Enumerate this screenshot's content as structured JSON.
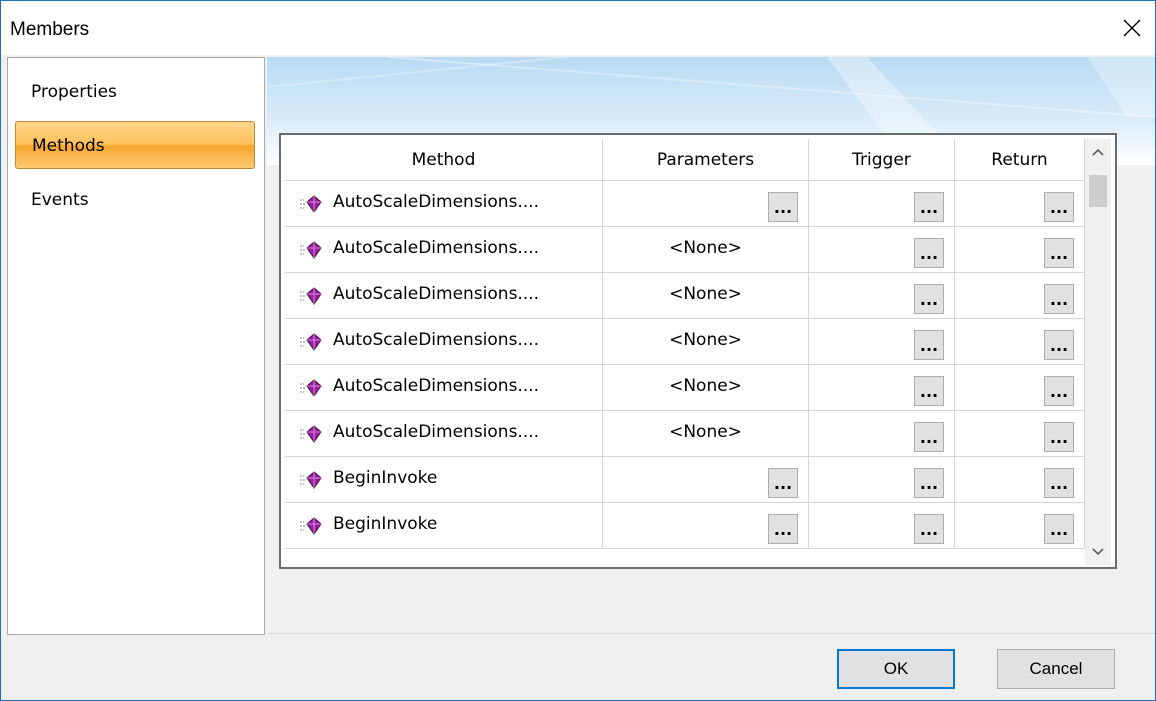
{
  "window": {
    "title": "Members",
    "close_icon": "close-icon"
  },
  "sidebar": {
    "items": [
      {
        "label": "Properties",
        "selected": false
      },
      {
        "label": "Methods",
        "selected": true
      },
      {
        "label": "Events",
        "selected": false
      }
    ]
  },
  "grid": {
    "headers": {
      "method": "Method",
      "parameters": "Parameters",
      "trigger": "Trigger",
      "return": "Return"
    },
    "rows": [
      {
        "method": "AutoScaleDimensions....",
        "parameters": "",
        "params_button": true
      },
      {
        "method": "AutoScaleDimensions....",
        "parameters": "<None>",
        "params_button": false
      },
      {
        "method": "AutoScaleDimensions....",
        "parameters": "<None>",
        "params_button": false
      },
      {
        "method": "AutoScaleDimensions....",
        "parameters": "<None>",
        "params_button": false
      },
      {
        "method": "AutoScaleDimensions....",
        "parameters": "<None>",
        "params_button": false
      },
      {
        "method": "AutoScaleDimensions....",
        "parameters": "<None>",
        "params_button": false
      },
      {
        "method": "BeginInvoke",
        "parameters": "",
        "params_button": true
      },
      {
        "method": "BeginInvoke",
        "parameters": "",
        "params_button": true
      }
    ],
    "button_label": "...",
    "method_icon": "method-icon",
    "colors": {
      "method_icon": "#9b1fa0"
    }
  },
  "buttons": {
    "ok": "OK",
    "cancel": "Cancel"
  },
  "colors": {
    "selected_item": "#ffc15a",
    "accent": "#0078d7"
  }
}
